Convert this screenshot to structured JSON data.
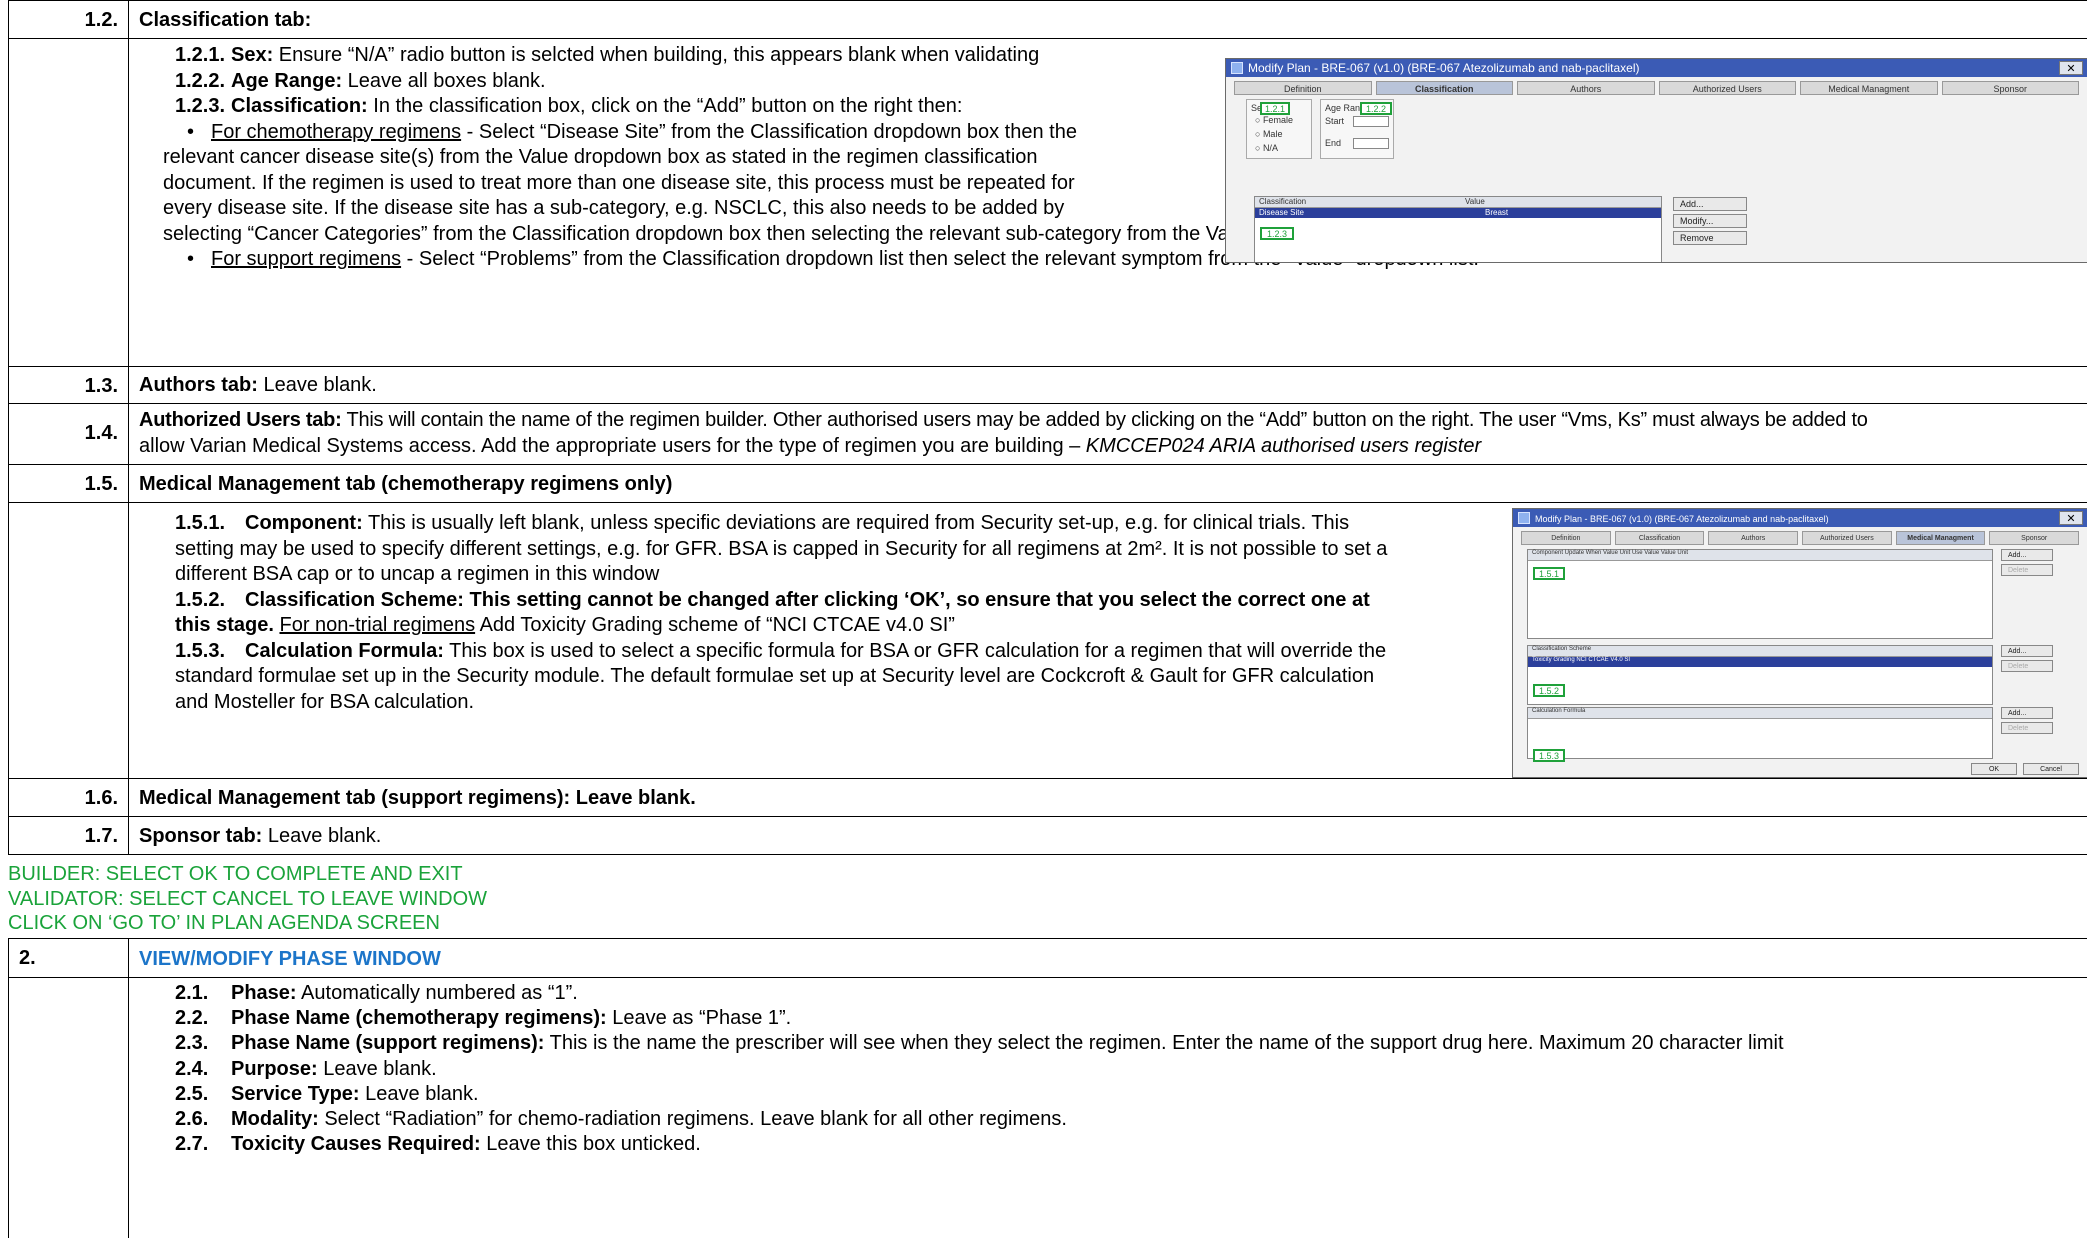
{
  "sections": {
    "s1_2": {
      "num": "1.2.",
      "title": "Classification tab:",
      "sex_num": "1.2.1.",
      "sex_label": "Sex:",
      "sex_text": " Ensure “N/A” radio button is selcted when building, this appears blank when validating",
      "age_num": "1.2.2.",
      "age_label": "Age Range:",
      "age_text": " Leave all boxes blank.",
      "class_num": "1.2.3.",
      "class_label": "Classification:",
      "class_text": " In the classification box, click on the “Add” button on the right then:",
      "bullet1_u": "For chemotherapy regimens",
      "bullet1_a": " - Select “Disease Site” from the Classification dropdown box  then the",
      "bullet1_b": "relevant cancer disease site(s) from the Value dropdown box as stated in the regimen classification",
      "bullet1_c": "document. If the regimen is used to treat more than one disease site, this process must be repeated for",
      "bullet1_d": "every disease site. If the disease site has a sub-category, e.g. NSCLC, this also needs to be added by",
      "bullet1_e": "selecting “Cancer Categories” from the Classification dropdown box then selecting the relevant sub-category from the Value dropdown box",
      "bullet2_u": "For support regimens",
      "bullet2_t": " - Select “Problems” from the Classification dropdown list then select the relevant symptom from the “Value” dropdown list."
    },
    "s1_3": {
      "num": "1.3.",
      "label": "Authors tab:",
      "text": " Leave blank."
    },
    "s1_4": {
      "num": "1.4.",
      "label": "Authorized Users tab:",
      "text_a": " This will contain the name of the regimen builder. Other authorised users may be added by clicking on the “Add” button on the right. The user “Vms, Ks” must always be added to",
      "text_b": "allow Varian Medical Systems access. Add the appropriate users for the type of regimen you are building – ",
      "text_i": "KMCCEP024 ARIA authorised users register"
    },
    "s1_5": {
      "num": "1.5.",
      "title": "Medical Management tab (chemotherapy regimens only)",
      "comp_num": "1.5.1.",
      "comp_label": "Component:",
      "comp_a": " This is usually left blank, unless specific deviations are required from Security set-up, e.g. for clinical trials. This",
      "comp_b": "setting may be used to specify different settings, e.g. for GFR. BSA is capped in Security for all regimens at 2m². It is not possible to set a",
      "comp_c": "different BSA cap or to uncap a regimen in this window",
      "scheme_num": "1.5.2.",
      "scheme_a": "Classification Scheme: This setting cannot be changed after clicking ‘OK’, so ensure that you select the correct one at",
      "scheme_b": "this stage.",
      "scheme_u": "For non-trial regimens",
      "scheme_c": " Add Toxicity Grading scheme of “NCI CTCAE v4.0 SI”",
      "calc_num": "1.5.3.",
      "calc_label": "Calculation Formula:",
      "calc_a": " This box is used to select a specific formula for BSA or GFR calculation for a regimen that will override the",
      "calc_b": "standard formulae set up in the Security module. The default formulae set up at Security level are Cockcroft & Gault for GFR calculation",
      "calc_c": "and Mosteller for BSA calculation."
    },
    "s1_6": {
      "num": "1.6.",
      "title": "Medical Management tab (support regimens): Leave blank."
    },
    "s1_7": {
      "num": "1.7.",
      "label": "Sponsor tab:",
      "text": " Leave blank."
    },
    "notes": {
      "line1": "BUILDER: SELECT OK TO COMPLETE AND EXIT",
      "line2": "VALIDATOR: SELECT CANCEL TO LEAVE WINDOW",
      "line3": "CLICK ON ‘GO TO’ IN PLAN AGENDA SCREEN"
    },
    "s2": {
      "num": "2.",
      "title": "VIEW/MODIFY PHASE WINDOW"
    },
    "s2_items": [
      {
        "num": "2.1.",
        "label": "Phase:",
        "text": " Automatically numbered as “1”."
      },
      {
        "num": "2.2.",
        "label": "Phase Name (chemotherapy regimens):",
        "text": " Leave as “Phase 1”."
      },
      {
        "num": "2.3.",
        "label": "Phase Name (support regimens):",
        "text": "  This is the name the prescriber will see when they select the regimen. Enter the name of the support drug here. Maximum 20 character limit"
      },
      {
        "num": "2.4.",
        "label": "Purpose:",
        "text": " Leave blank."
      },
      {
        "num": "2.5.",
        "label": "Service Type:",
        "text": " Leave blank."
      },
      {
        "num": "2.6.",
        "label": "Modality:",
        "text": " Select “Radiation” for chemo-radiation regimens. Leave blank for all other regimens."
      },
      {
        "num": "2.7.",
        "label": "Toxicity Causes Required:",
        "text": " Leave this box unticked."
      }
    ]
  },
  "screenshot1": {
    "title": "Modify Plan - BRE-067 (v1.0) (BRE-067 Atezolizumab and nab-paclitaxel)",
    "close": "✕",
    "tabs": [
      "Definition",
      "Classification",
      "Authors",
      "Authorized Users",
      "Medical Managment",
      "Sponsor"
    ],
    "sex_label": "Sex",
    "radio_female": "Female",
    "radio_male": "Male",
    "radio_na": "N/A",
    "age_label": "Age Range",
    "start_label": "Start",
    "end_label": "End",
    "col_class": "Classification",
    "col_value": "Value",
    "row_class": "Disease Site",
    "row_value": "Breast",
    "btn_add": "Add...",
    "btn_modify": "Modify...",
    "btn_remove": "Remove",
    "tag1": "1.2.1",
    "tag2": "1.2.2",
    "tag3": "1.2.3"
  },
  "screenshot2": {
    "title": "Modify Plan - BRE-067 (v1.0) (BRE-067 Atezolizumab and nab-paclitaxel)",
    "close": "✕",
    "tabs": [
      "Definition",
      "Classification",
      "Authors",
      "Authorized Users",
      "Medical Managment",
      "Sponsor"
    ],
    "grid1_cols": "Component        Update When    Value    Unit        Use Value    Value    Unit",
    "grid2_cols": "Classification        Scheme",
    "grid2_row": "Toxicity Grading        NCI CTCAE V4.0 SI",
    "grid3_cols": "Calculation        Formula",
    "btn_add": "Add...",
    "btn_delete": "Delete",
    "btn_ok": "OK",
    "btn_cancel": "Cancel",
    "tag1": "1.5.1",
    "tag2": "1.5.2",
    "tag3": "1.5.3"
  }
}
